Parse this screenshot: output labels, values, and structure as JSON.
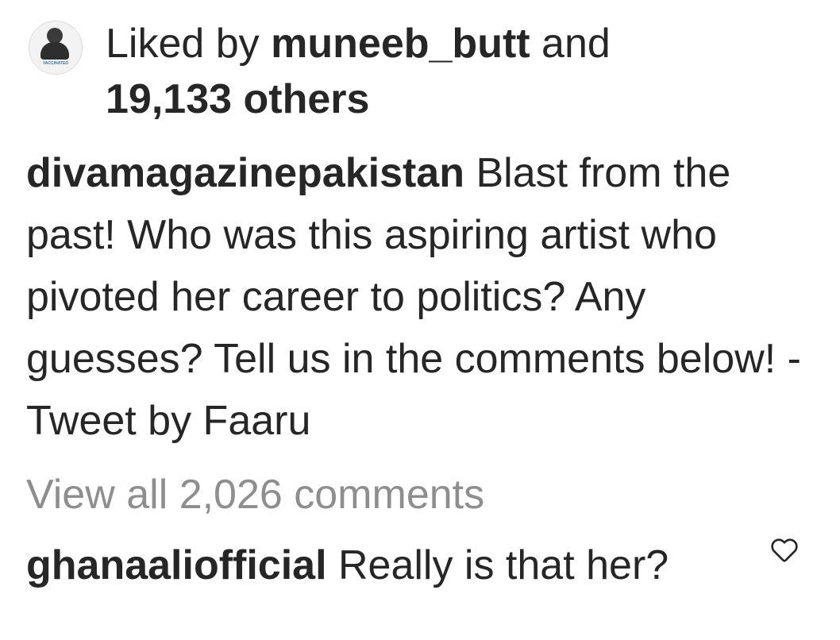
{
  "likes": {
    "avatar_badge": "VACCINATED",
    "prefix": "Liked by",
    "user": "muneeb_butt",
    "connector": "and",
    "others": "19,133 others"
  },
  "post": {
    "username": "divamagazinepakistan",
    "caption": "Blast from the past! Who was this aspiring artist who pivoted her career to politics? Any guesses? Tell us in the comments below! - Tweet by Faaru"
  },
  "comments_link": "View all 2,026 comments",
  "comment": {
    "username": "ghanaaliofficial",
    "text": "Really is that her?",
    "like_icon": "heart-outline-icon"
  },
  "colors": {
    "text": "#262626",
    "muted": "#8e8e8e",
    "background": "#ffffff"
  }
}
